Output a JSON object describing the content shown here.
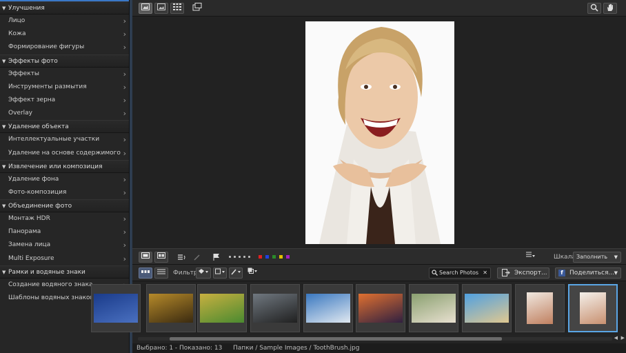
{
  "sidebar": {
    "sections": [
      {
        "title": "Улучшения",
        "items": [
          "Лицо",
          "Кожа",
          "Формирование фигуры"
        ]
      },
      {
        "title": "Эффекты фото",
        "items": [
          "Эффекты",
          "Инструменты размытия",
          "Эффект зерна",
          "Overlay"
        ]
      },
      {
        "title": "Удаление объекта",
        "items": [
          "Интеллектуальные участки",
          "Удаление на основе содержимого"
        ]
      },
      {
        "title": "Извлечение или композиция",
        "items": [
          "Удаление фона",
          "Фото-композиция"
        ]
      },
      {
        "title": "Объединение фото",
        "items": [
          "Монтаж HDR",
          "Панорама",
          "Замена лица",
          "Multi Exposure"
        ]
      },
      {
        "title": "Рамки и водяные знаки",
        "items": [
          "Создание водяного знака",
          "Шаблоны водяных знаков"
        ]
      }
    ]
  },
  "toolbar": {
    "view_buttons": [
      "single-view-icon",
      "photo-view-icon",
      "grid-view-icon"
    ],
    "compare_icon": "compare-icon",
    "zoom_icon": "magnifier-icon",
    "pan_icon": "hand-icon"
  },
  "filter": {
    "scale_label": "Шкала:",
    "scale_value": "Заполнить",
    "filter_label": "Фильтр:",
    "search_placeholder": "Search Photos",
    "export_label": "Экспорт...",
    "share_label": "Поделиться...",
    "color_labels": [
      "#e02020",
      "#2040e0",
      "#2a8a2a",
      "#e0c000",
      "#a020c0"
    ]
  },
  "thumbnails": [
    {
      "name": "partial",
      "colors": [
        "#1a3b8a",
        "#4a70c0"
      ]
    },
    {
      "name": "spiral",
      "colors": [
        "#b68a2a",
        "#3a2a10"
      ]
    },
    {
      "name": "bicycle",
      "colors": [
        "#c8b040",
        "#4a8a30"
      ]
    },
    {
      "name": "ship",
      "colors": [
        "#707880",
        "#202020"
      ]
    },
    {
      "name": "city-bay",
      "colors": [
        "#3a78c0",
        "#e0e8f0"
      ]
    },
    {
      "name": "sunset",
      "colors": [
        "#e07030",
        "#302040"
      ]
    },
    {
      "name": "kitten",
      "colors": [
        "#8aa070",
        "#e8e0d0"
      ]
    },
    {
      "name": "beach",
      "colors": [
        "#50a0e0",
        "#e0c890"
      ]
    },
    {
      "name": "woman-smile",
      "colors": [
        "#f0e8e0",
        "#c08060"
      ]
    },
    {
      "name": "laughing-woman",
      "colors": [
        "#f4f0ea",
        "#c89070"
      ]
    }
  ],
  "status": {
    "selected": "Выбрано: 1 - Показано: 13",
    "path": "Папки / Sample Images / ToothBrush.jpg"
  }
}
